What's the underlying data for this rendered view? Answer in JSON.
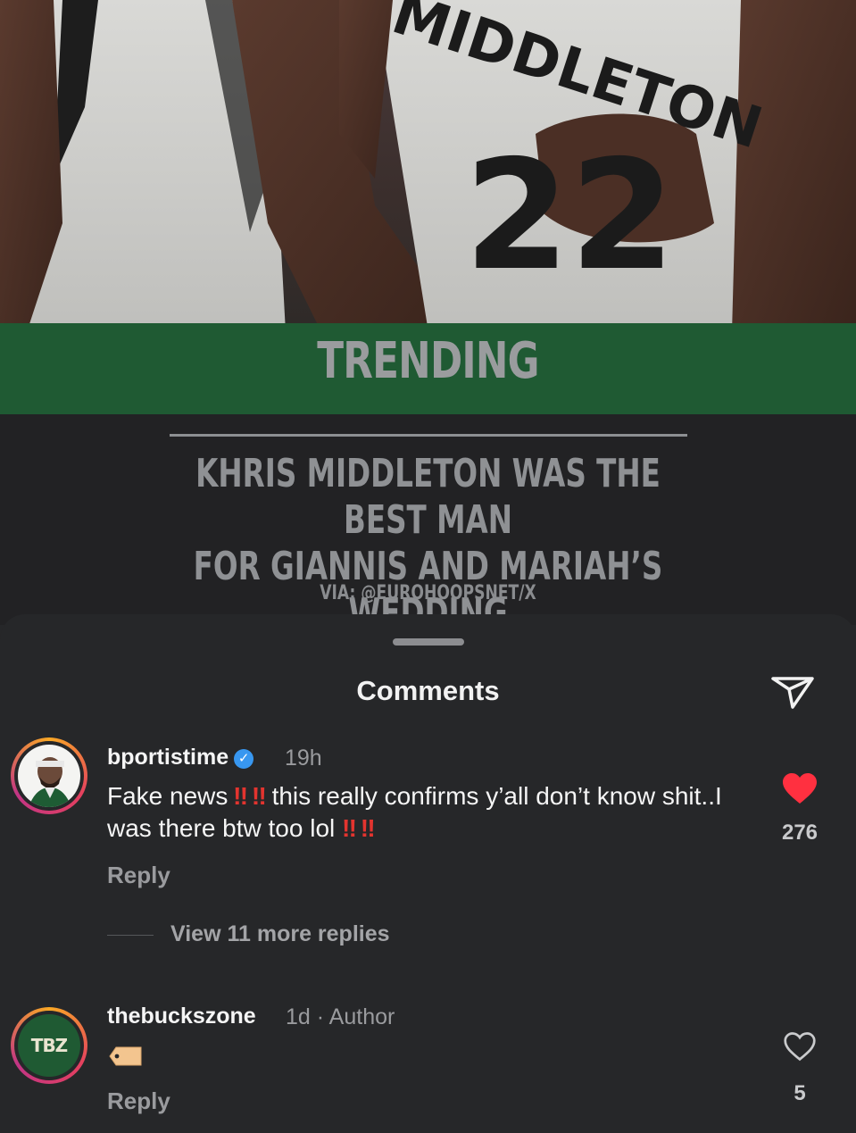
{
  "post": {
    "jersey_name": "MIDDLETON",
    "jersey_number": "22",
    "banner_title": "TRENDING",
    "headline_line1": "KHRIS MIDDLETON WAS THE BEST MAN",
    "headline_line2": "FOR GIANNIS AND MARIAH’S WEDDING",
    "source": "VIA: @EUROHOOPSNET/X"
  },
  "sheet": {
    "title": "Comments"
  },
  "comments": [
    {
      "username": "bportistime",
      "verified": true,
      "time": "19h",
      "body_part1": "Fake news",
      "body_excl1": "‼️ ‼️",
      "body_part2": " this really confirms y’all don’t know shit..I was there btw too lol ",
      "body_excl2": "‼️ ‼️",
      "reply_label": "Reply",
      "liked": true,
      "likes": "276",
      "view_replies": "View 11 more replies"
    },
    {
      "username": "thebuckszone",
      "time": "1d",
      "separator": "·",
      "author_label": "Author",
      "avatar_text": "TBZ",
      "reply_label": "Reply",
      "liked": false,
      "likes": "5"
    }
  ],
  "colors": {
    "like_red": "#ff3040",
    "bucks_green": "#1f5a33",
    "verified_blue": "#3897f0"
  },
  "icons": {
    "share": "paper-plane-icon",
    "like_filled": "heart-filled-icon",
    "like_outline": "heart-outline-icon",
    "verified": "verified-badge-icon"
  }
}
